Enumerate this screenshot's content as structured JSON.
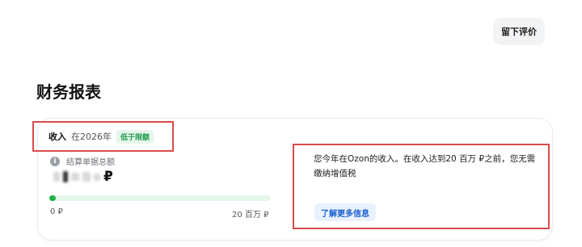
{
  "header": {
    "review_button_label": "留下评价"
  },
  "page": {
    "title": "财务报表"
  },
  "income_card": {
    "income_label": "收入",
    "year_text": "在2026年",
    "limit_badge": "低于限额",
    "total_label": "结算单据总额",
    "amount_currency": "₽",
    "progress": {
      "value_fraction": 0.02,
      "min_label": "0 ₽",
      "max_label": "20 百万 ₽"
    },
    "info_text": "您今年在Ozon的收入。在收入达到20 百万 ₽之前，您无需缴纳增值税",
    "learn_more_label": "了解更多信息"
  },
  "colors": {
    "accent_green": "#21b24b",
    "highlight_red": "#d94a4a",
    "link_blue": "#1a5fd0"
  }
}
